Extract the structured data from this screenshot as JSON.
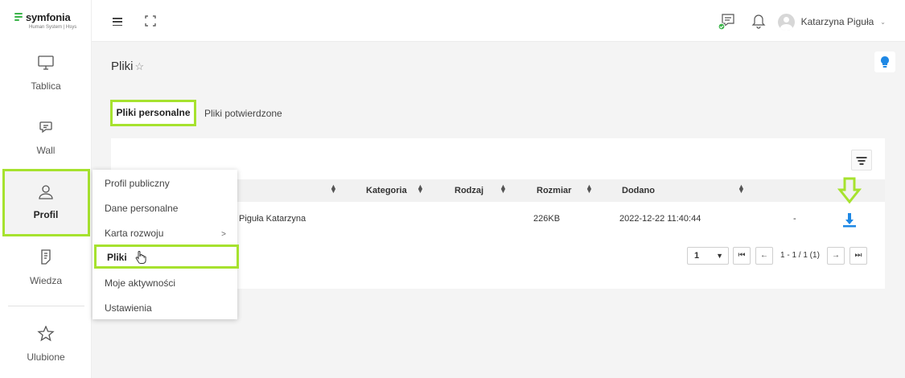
{
  "brand": {
    "name": "symfonia",
    "subtitle": "Human System | Hsys",
    "accent": "#3bb44a",
    "highlight": "#a6e22e"
  },
  "sidebar": {
    "items": [
      {
        "label": "Tablica",
        "icon": "monitor-icon"
      },
      {
        "label": "Wall",
        "icon": "chat-icon"
      },
      {
        "label": "Profil",
        "icon": "user-icon",
        "active": true
      },
      {
        "label": "Wiedza",
        "icon": "document-icon"
      },
      {
        "label": "Ulubione",
        "icon": "star-icon"
      }
    ]
  },
  "topbar": {
    "user_name": "Katarzyna Piguła",
    "icons": [
      "menu-icon",
      "fullscreen-icon",
      "messages-icon",
      "bell-icon",
      "chevron-down-icon"
    ]
  },
  "page": {
    "title": "Pliki",
    "help_icon": "lightbulb-icon"
  },
  "tabs": [
    {
      "label": "Pliki personalne",
      "active": true
    },
    {
      "label": "Pliki potwierdzone",
      "active": false
    }
  ],
  "table": {
    "columns": [
      "Kategoria",
      "Rodzaj",
      "Rozmiar",
      "Dodano"
    ],
    "rows": [
      {
        "name": "Piguła Katarzyna",
        "size": "226KB",
        "added": "2022-12-22 11:40:44",
        "extra": "-"
      }
    ]
  },
  "pagination": {
    "page": "1",
    "info": "1 - 1 / 1 (1)"
  },
  "submenu": {
    "items": [
      {
        "label": "Profil publiczny"
      },
      {
        "label": "Dane personalne"
      },
      {
        "label": "Karta rozwoju",
        "has_children": true
      },
      {
        "label": "Pliki",
        "active": true
      },
      {
        "label": "Moje aktywności"
      },
      {
        "label": "Ustawienia"
      }
    ]
  }
}
